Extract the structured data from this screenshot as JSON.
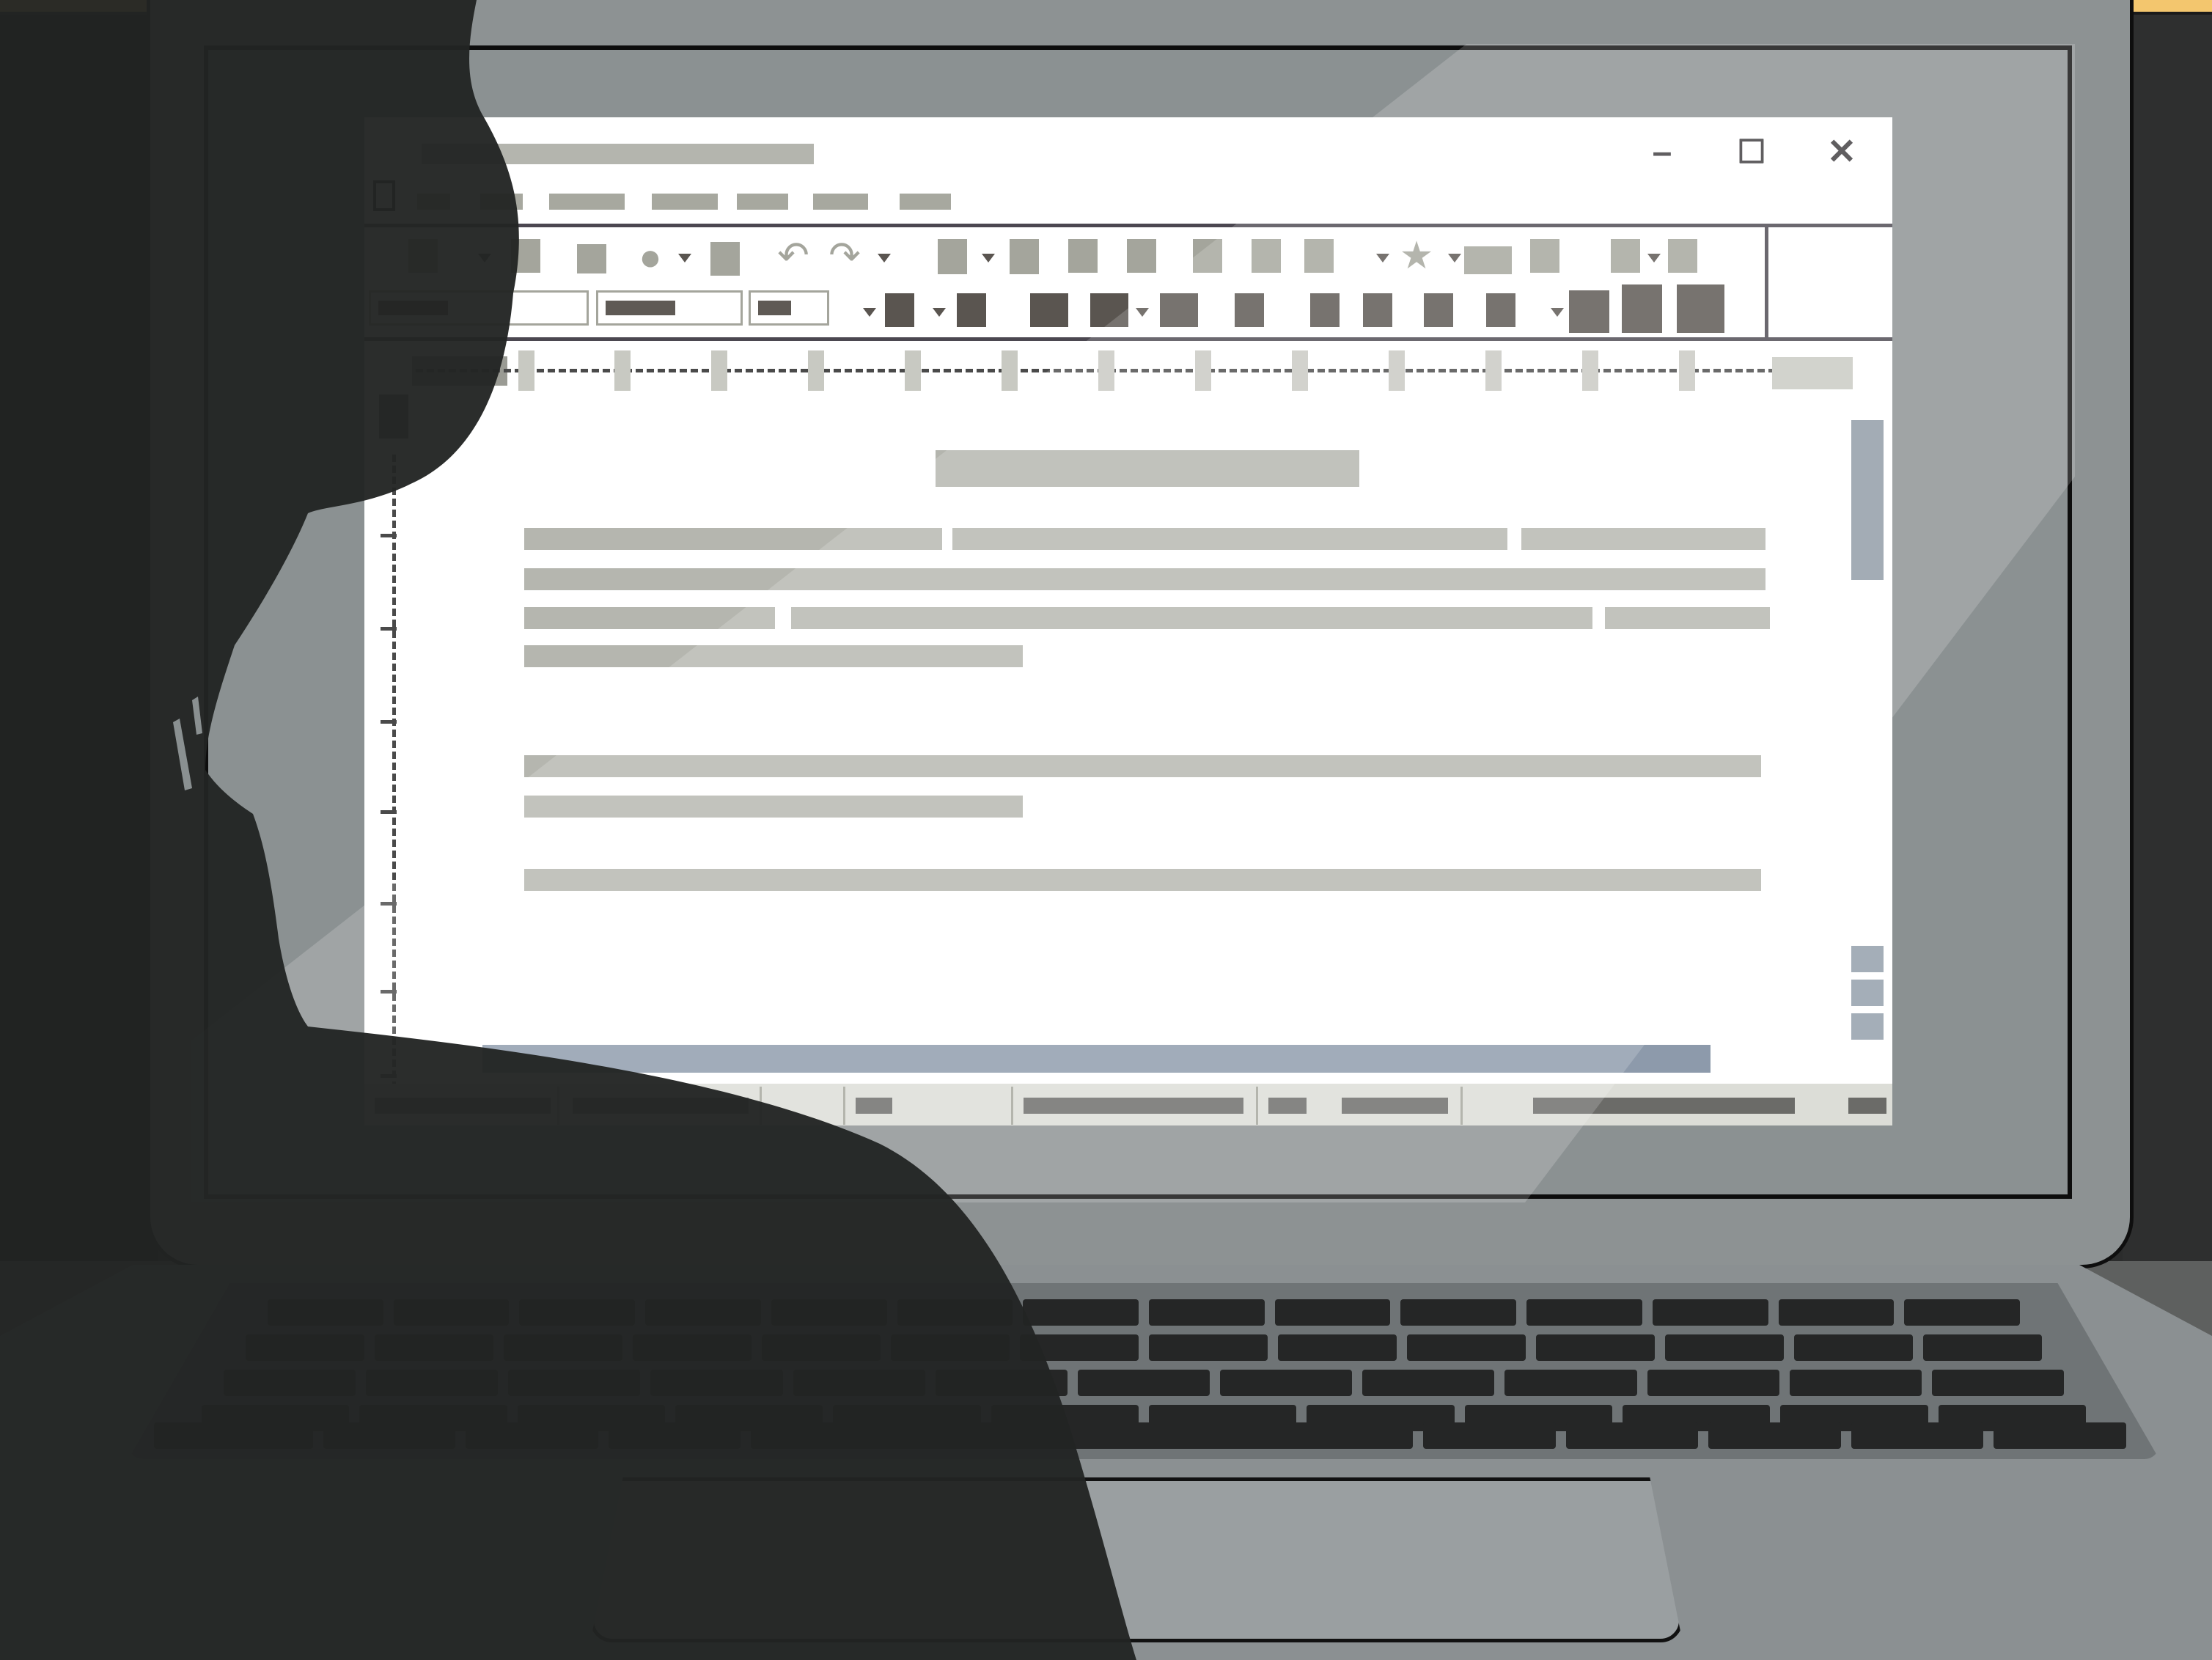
{
  "scene": {
    "description_tag": "",
    "colors": {
      "top_band": "#f3c66e",
      "window_bg": "#ffffff",
      "placeholder_gray": "#b5b6af",
      "scrollbar_blue": "#8f9aa5",
      "toolbar_dark": "#5a5550",
      "lid": "#8d9293"
    }
  },
  "window": {
    "controls": {
      "minimize_glyph": "–",
      "maximize_glyph": "☐",
      "close_glyph": "✕"
    },
    "toolbar": {
      "undo_glyph": "↶",
      "redo_glyph": "↷",
      "star_glyph": "★",
      "circle_glyph": "●"
    }
  }
}
